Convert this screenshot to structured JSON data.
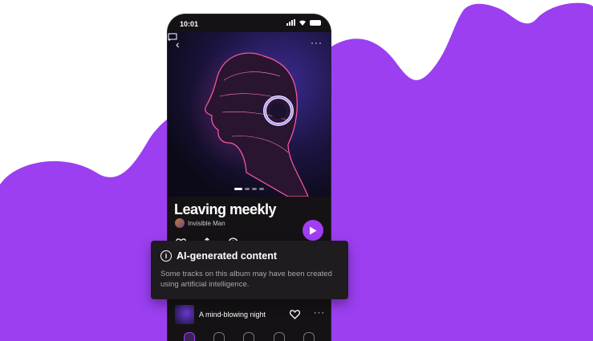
{
  "status_bar": {
    "time": "10:01"
  },
  "album": {
    "title": "Leaving meekly",
    "artist": "Invisible Man"
  },
  "tooltip": {
    "title": "AI-generated content",
    "body": "Some tracks on this album may have been created using artificial intelligence."
  },
  "track": {
    "title": "A mind-blowing night"
  },
  "icons": {
    "back": "back-arrow-icon",
    "cast": "cast-icon",
    "more": "more-horizontal-icon",
    "like": "heart-icon",
    "share": "share-icon",
    "download": "download-icon",
    "play": "play-icon",
    "info": "info-icon"
  },
  "colors": {
    "accent": "#a23cf5",
    "background_blob": "#9b3ff0",
    "phone_bg": "#141214",
    "tooltip_bg": "#1e1c1f"
  }
}
